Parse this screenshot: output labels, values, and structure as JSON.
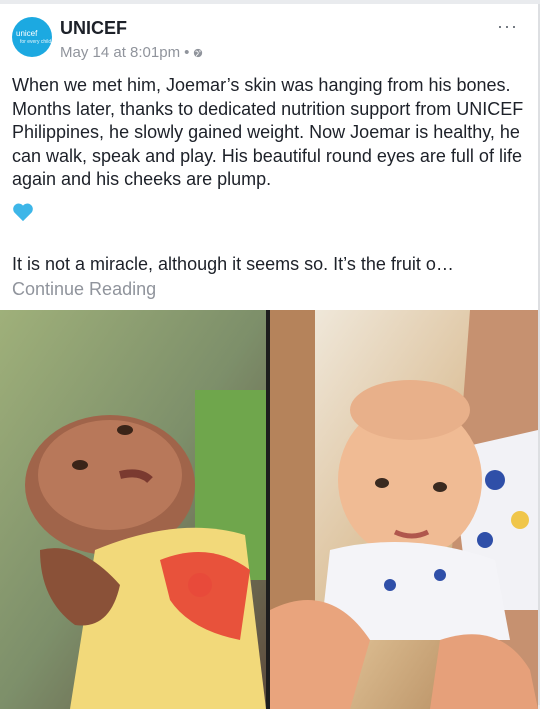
{
  "post": {
    "page_name": "UNICEF",
    "avatar_logo": "unicef",
    "avatar_sub": "for every child",
    "date": "May 14 at 8:01pm",
    "dot": "•",
    "more_icon": "more-horizontal-icon",
    "privacy_icon": "globe-icon",
    "text": "When we met him, Joemar’s skin was hanging from his bones. Months later, thanks to dedicated nutrition support from UNICEF Philippines, he slowly gained weight. Now Joemar is healthy, he can walk, speak and play. His beautiful round eyes are full of life again and his cheeks are plump.",
    "heart_icon": "blue-heart-icon",
    "heart_color": "#3db6e8",
    "text_2": "It is not a miracle, although it seems so. It’s the fruit o…",
    "continue_label": "Continue Reading"
  },
  "photo": {
    "left_subject": "malnourished baby",
    "right_subject": "healthy baby"
  }
}
